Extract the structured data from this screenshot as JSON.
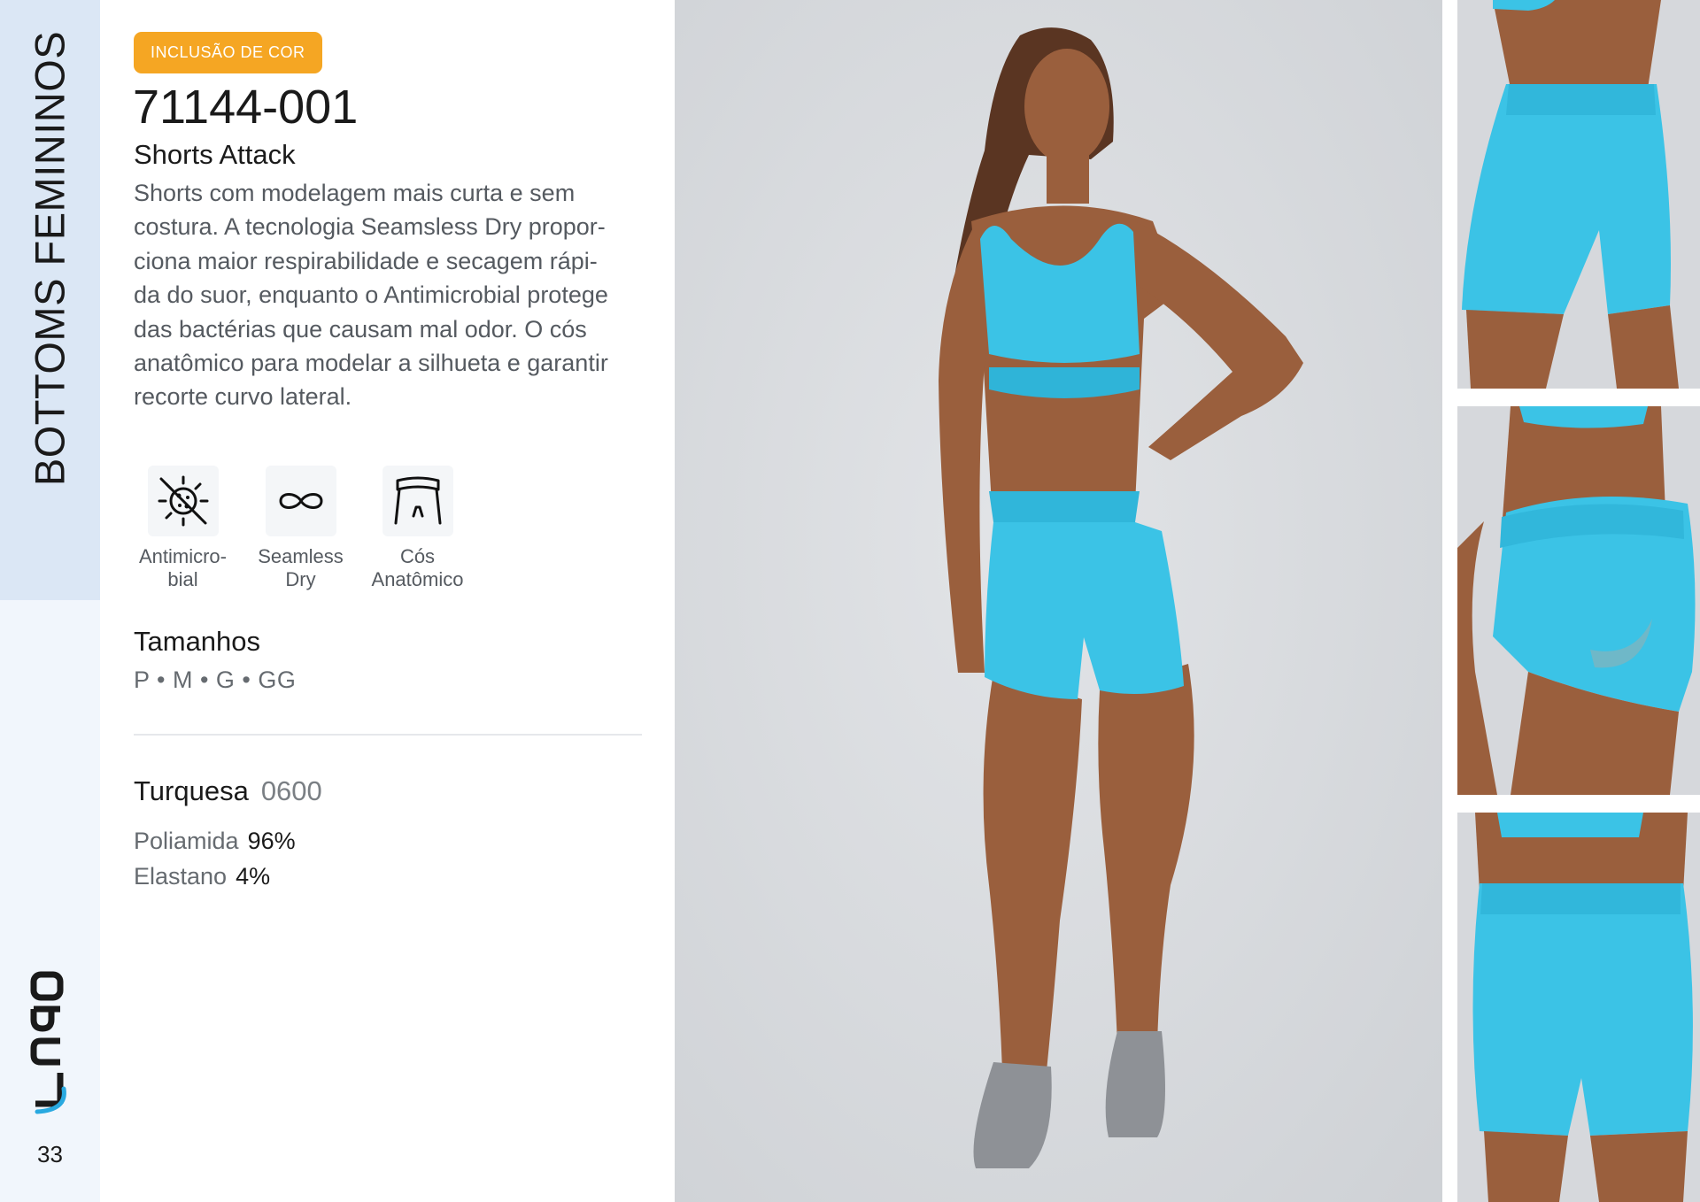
{
  "sidebar": {
    "category": "BOTTOMS FEMININOS",
    "brand": "LUPO",
    "page_number": "33"
  },
  "product": {
    "badge": "INCLUSÃO DE COR",
    "code": "71144-001",
    "name": "Shorts Attack",
    "description_lines": [
      "Shorts com modelagem mais curta e sem",
      "costura. A tecnologia Seamsless Dry propor-",
      "ciona maior respirabilidade e secagem rápi-",
      "da do suor, enquanto o Antimicrobial protege",
      "das bactérias que causam mal odor. O cós",
      "anatômico para modelar a silhueta e garantir",
      "recorte curvo lateral."
    ]
  },
  "features": [
    {
      "icon": "antimicrobial-icon",
      "label_lines": [
        "Antimicro-",
        "bial"
      ]
    },
    {
      "icon": "infinity-icon",
      "label_lines": [
        "Seamless",
        "Dry"
      ]
    },
    {
      "icon": "waistband-icon",
      "label_lines": [
        "Cós",
        "Anatômico"
      ]
    }
  ],
  "sizes": {
    "title": "Tamanhos",
    "list": "P • M • G • GG"
  },
  "color": {
    "name": "Turquesa",
    "code": "0600",
    "swatch": "#3bc3e6"
  },
  "composition": [
    {
      "material": "Poliamida",
      "percent": "96%"
    },
    {
      "material": "Elastano",
      "percent": "4%"
    }
  ],
  "colors": {
    "badge": "#f5a623",
    "sidebar_top": "#dbe7f5",
    "sidebar_bottom": "#f1f6fc",
    "logo_blue": "#29a9e0",
    "skin": "#9a5f3d",
    "turquoise": "#3bc3e6"
  }
}
